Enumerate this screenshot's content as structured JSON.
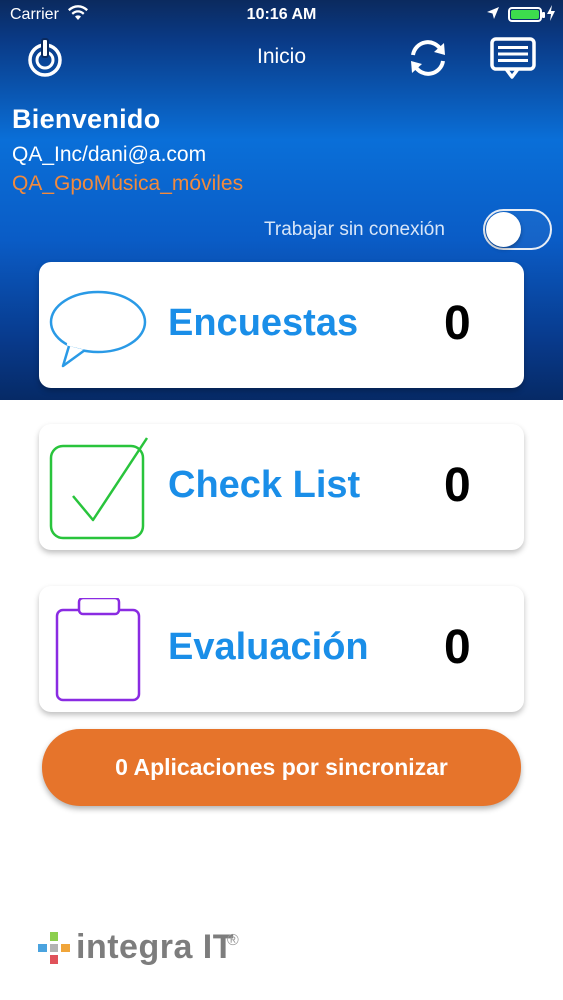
{
  "status_bar": {
    "carrier": "Carrier",
    "time": "10:16 AM",
    "battery_level": 1.0
  },
  "nav": {
    "title": "Inicio",
    "left_icon": "power-icon",
    "right_icons": [
      "sync-icon",
      "messages-icon"
    ]
  },
  "header": {
    "welcome": "Bienvenido",
    "user": "QA_Inc/dani@a.com",
    "group": "QA_GpoMúsica_móviles",
    "offline_label": "Trabajar sin conexión",
    "offline_enabled": false
  },
  "cards": [
    {
      "label": "Encuestas",
      "count": "0",
      "icon": "speech-bubble-icon",
      "color": "#2a9ae6"
    },
    {
      "label": "Check List",
      "count": "0",
      "icon": "checkbox-icon",
      "color": "#29c43c"
    },
    {
      "label": "Evaluación",
      "count": "0",
      "icon": "clipboard-icon",
      "color": "#8a2be2"
    }
  ],
  "sync_button": {
    "label": "0 Aplicaciones por sincronizar"
  },
  "footer": {
    "logo_text": "integra IT",
    "registered": "®"
  },
  "colors": {
    "accent_blue": "#1a8ee8",
    "accent_orange": "#e6742b",
    "group_text": "#f28a3c"
  }
}
